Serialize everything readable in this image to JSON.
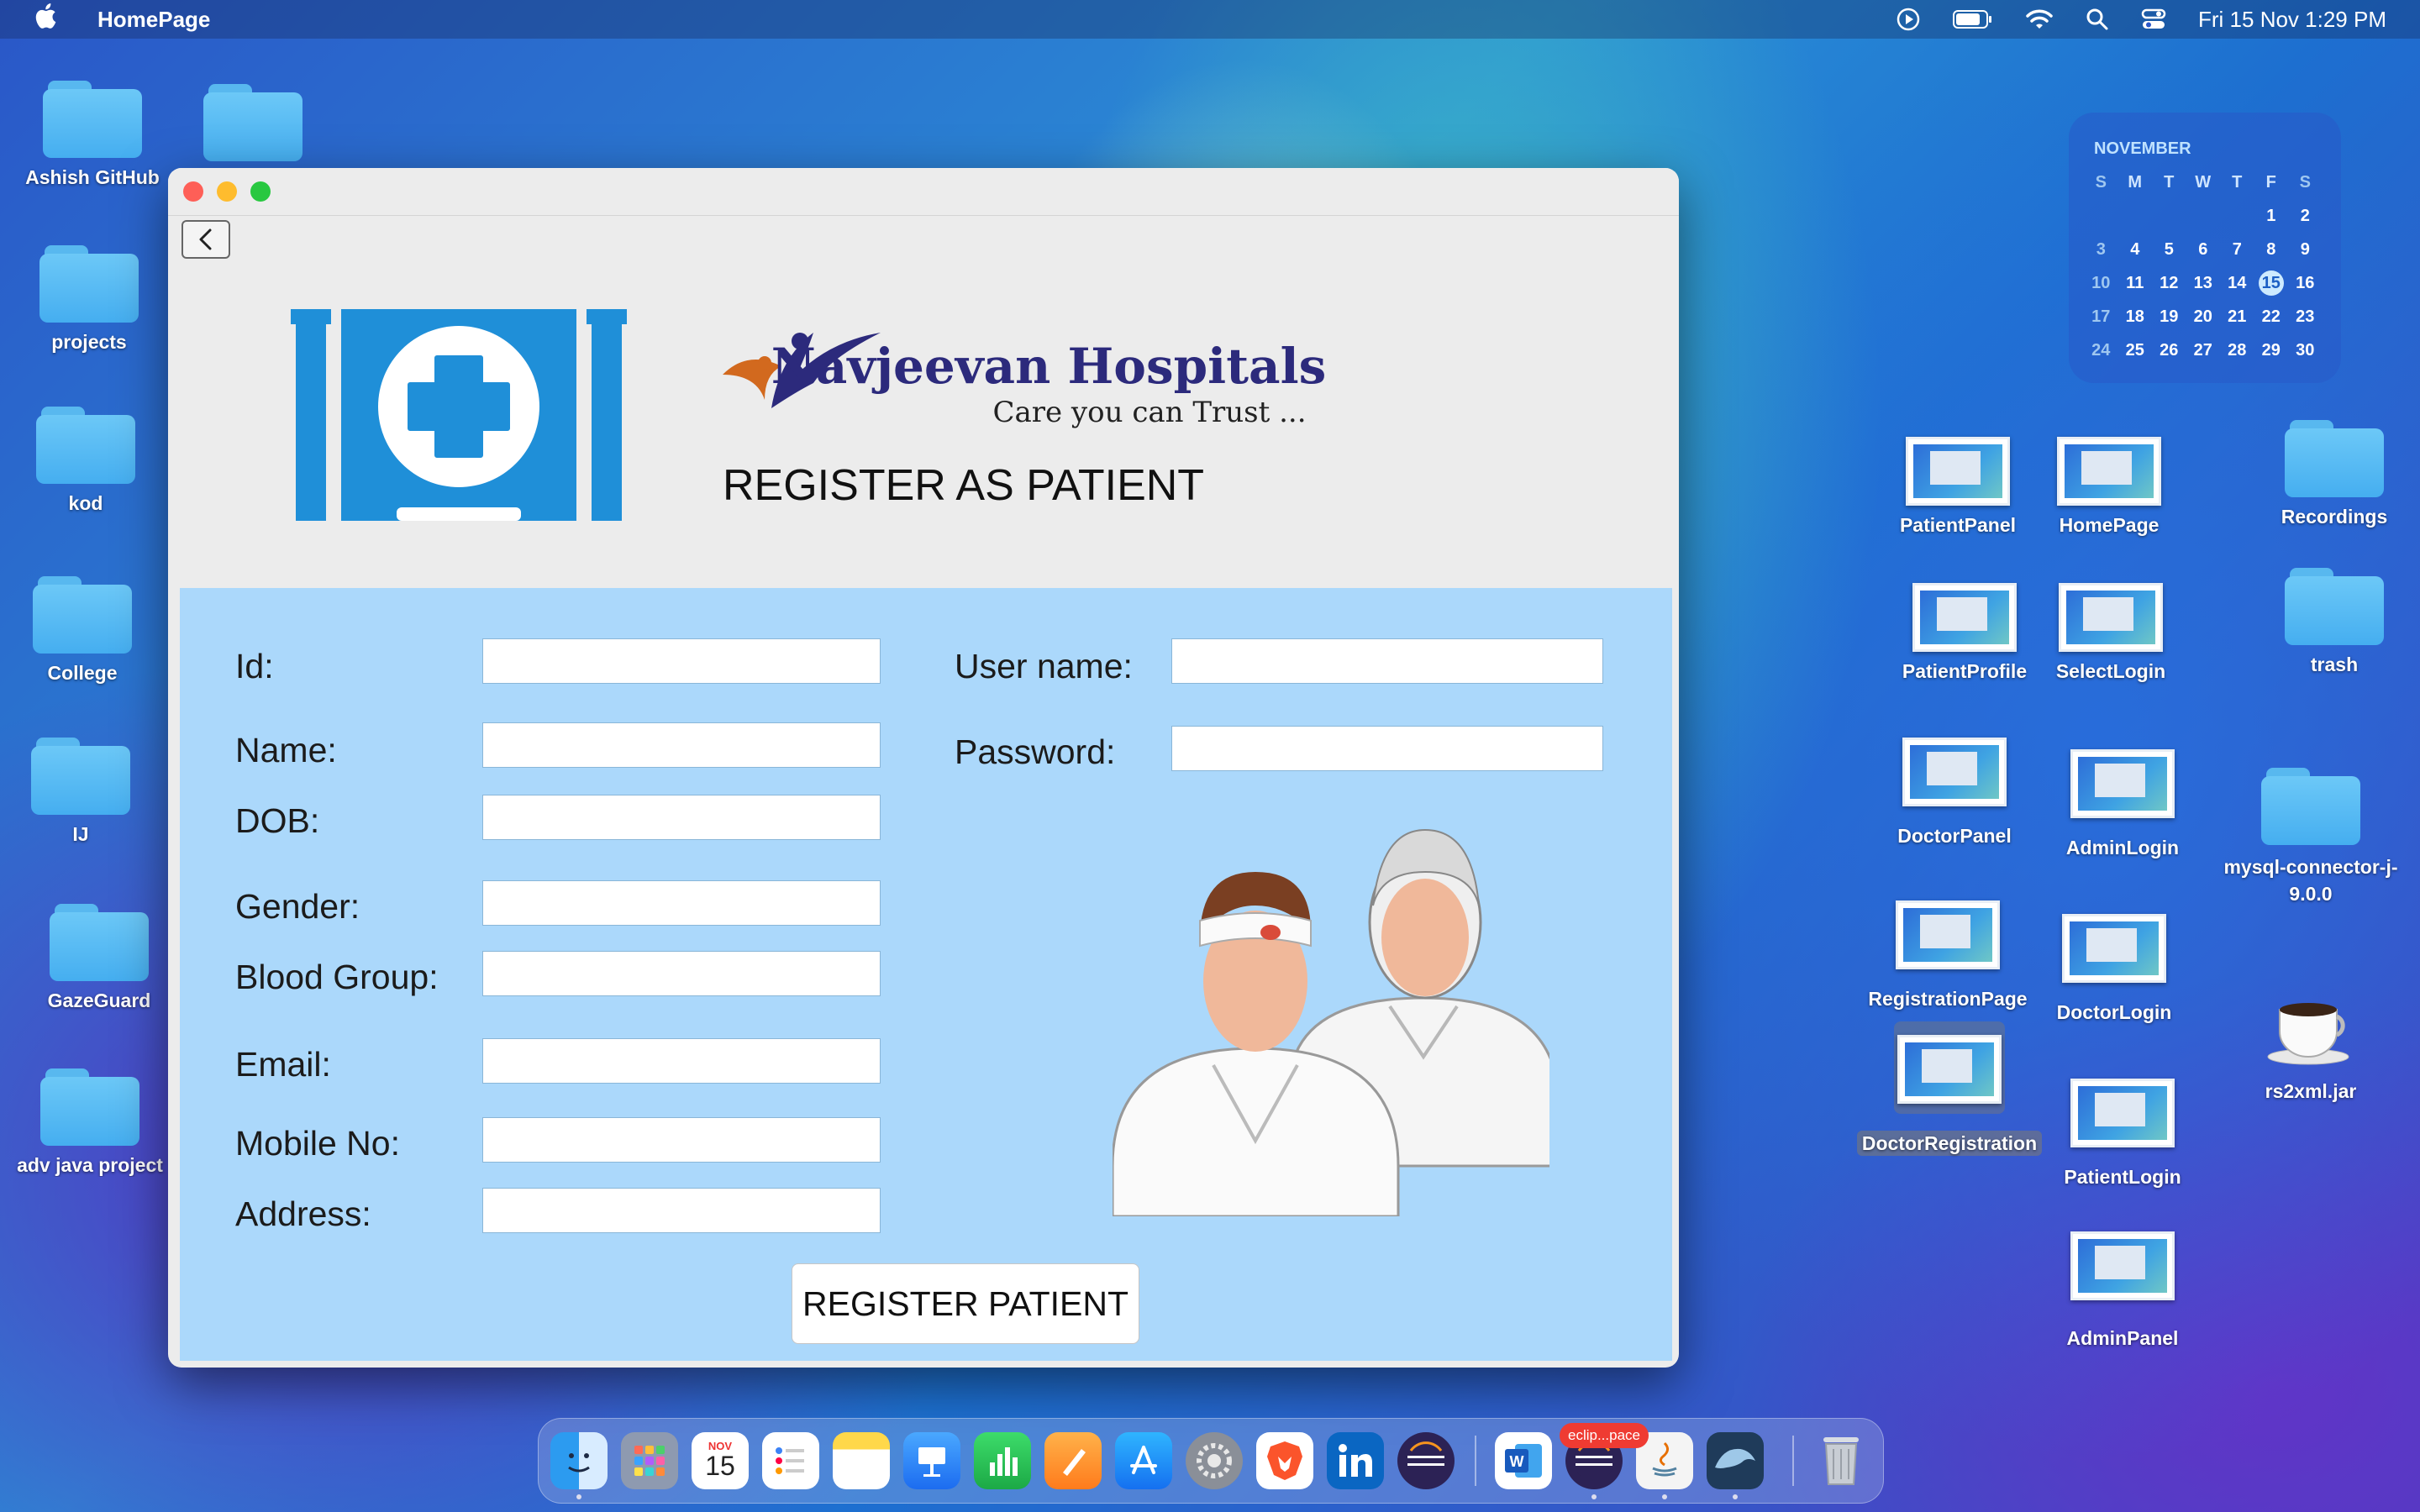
{
  "menubar": {
    "app_name": "HomePage",
    "datetime": "Fri 15 Nov  1:29 PM"
  },
  "desktop_left": [
    {
      "label": "Ashish GitHub"
    },
    {
      "label": "projects"
    },
    {
      "label": "kod"
    },
    {
      "label": "College"
    },
    {
      "label": "IJ"
    },
    {
      "label": "GazeGuard"
    },
    {
      "label": "adv java project"
    }
  ],
  "desktop_right": {
    "patient_panel": "PatientPanel",
    "home_page": "HomePage",
    "recordings": "Recordings",
    "patient_profile": "PatientProfile",
    "select_login": "SelectLogin",
    "trash": "trash",
    "doctor_panel": "DoctorPanel",
    "admin_login": "AdminLogin",
    "mysql_connector": "mysql-connector-j-9.0.0",
    "registration_page": "RegistrationPage",
    "doctor_login": "DoctorLogin",
    "rs2xml": "rs2xml.jar",
    "doctor_registration": "DoctorRegistration",
    "patient_login": "PatientLogin",
    "admin_panel": "AdminPanel"
  },
  "calendar": {
    "month": "NOVEMBER",
    "weekdays": [
      "S",
      "M",
      "T",
      "W",
      "T",
      "F",
      "S"
    ],
    "weeks": [
      [
        "",
        "",
        "",
        "",
        "",
        "1",
        "2"
      ],
      [
        "3",
        "4",
        "5",
        "6",
        "7",
        "8",
        "9"
      ],
      [
        "10",
        "11",
        "12",
        "13",
        "14",
        "15",
        "16"
      ],
      [
        "17",
        "18",
        "19",
        "20",
        "21",
        "22",
        "23"
      ],
      [
        "24",
        "25",
        "26",
        "27",
        "28",
        "29",
        "30"
      ]
    ],
    "today": "15"
  },
  "window": {
    "logo_name": "Navjeevan Hospitals",
    "logo_tagline": "Care you can Trust ...",
    "title": "REGISTER AS PATIENT",
    "labels": {
      "id": "Id:",
      "name": "Name:",
      "dob": "DOB:",
      "gender": "Gender:",
      "blood_group": "Blood Group:",
      "email": "Email:",
      "mobile": "Mobile No:",
      "address": "Address:",
      "username": "User name:",
      "password": "Password:"
    },
    "values": {
      "id": "",
      "name": "",
      "dob": "",
      "gender": "",
      "blood_group": "",
      "email": "",
      "mobile": "",
      "address": "",
      "username": "",
      "password": ""
    },
    "submit_label": "REGISTER PATIENT"
  },
  "dock": {
    "calendar_month": "NOV",
    "calendar_day": "15",
    "eclipse_badge": "eclip...pace"
  }
}
